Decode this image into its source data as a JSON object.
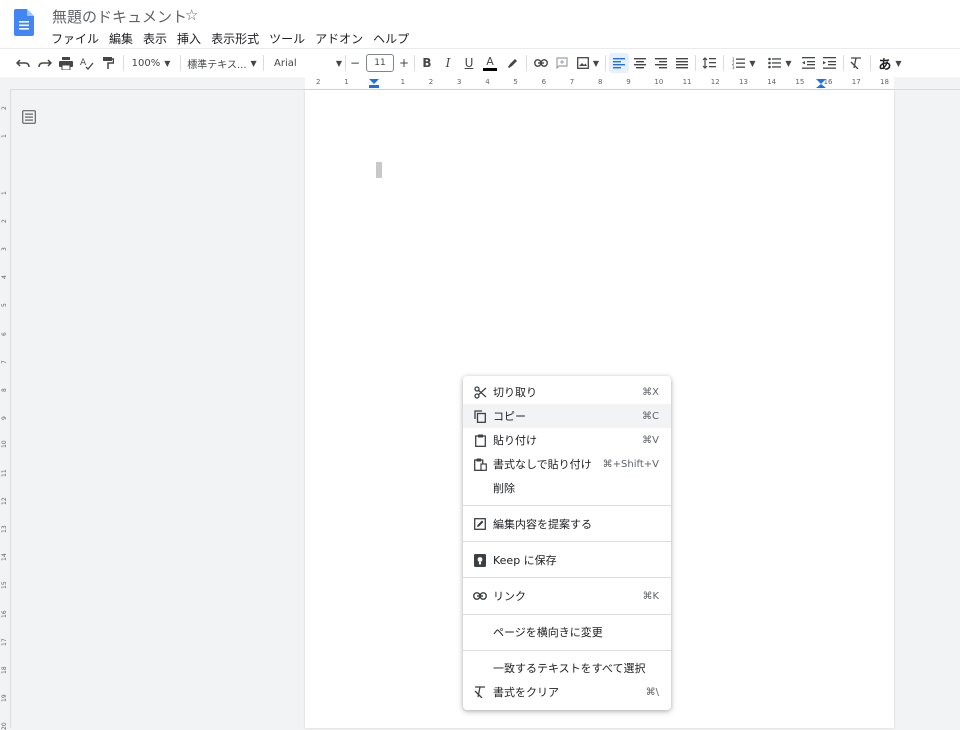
{
  "doc": {
    "title": "無題のドキュメント"
  },
  "menubar": [
    "ファイル",
    "編集",
    "表示",
    "挿入",
    "表示形式",
    "ツール",
    "アドオン",
    "ヘルプ"
  ],
  "toolbar": {
    "zoom": "100%",
    "style": "標準テキス...",
    "font": "Arial",
    "font_size": "11",
    "minus": "−",
    "plus": "+",
    "bold": "B",
    "italic": "I",
    "underline": "U",
    "text_color": "A",
    "input_tools": "あ"
  },
  "ruler": {
    "top_ticks": [
      "2",
      "1",
      "1",
      "2",
      "3",
      "4",
      "5",
      "6",
      "7",
      "8",
      "9",
      "10",
      "11",
      "12",
      "13",
      "14",
      "15",
      "16",
      "17",
      "18"
    ],
    "left_ticks": [
      "2",
      "1",
      "1",
      "2",
      "3",
      "4",
      "5",
      "6",
      "7",
      "8",
      "9",
      "10",
      "11",
      "12",
      "13",
      "14",
      "15",
      "16",
      "17",
      "18",
      "19",
      "20"
    ]
  },
  "context_menu": {
    "items": [
      {
        "label": "切り取り",
        "shortcut": "⌘X",
        "icon": "scissors-icon"
      },
      {
        "label": "コピー",
        "shortcut": "⌘C",
        "icon": "copy-icon"
      },
      {
        "label": "貼り付け",
        "shortcut": "⌘V",
        "icon": "clipboard-icon"
      },
      {
        "label": "書式なしで貼り付け",
        "shortcut": "⌘+Shift+V",
        "icon": "paste-plain-icon"
      },
      {
        "label": "削除",
        "shortcut": "",
        "icon": ""
      },
      {
        "label": "編集内容を提案する",
        "shortcut": "",
        "icon": "suggest-edit-icon"
      },
      {
        "label": "Keep に保存",
        "shortcut": "",
        "icon": "keep-icon"
      },
      {
        "label": "リンク",
        "shortcut": "⌘K",
        "icon": "link-icon"
      },
      {
        "label": "ページを横向きに変更",
        "shortcut": "",
        "icon": ""
      },
      {
        "label": "一致するテキストをすべて選択",
        "shortcut": "",
        "icon": ""
      },
      {
        "label": "書式をクリア",
        "shortcut": "⌘\\",
        "icon": "clear-format-icon"
      }
    ]
  },
  "colors": {
    "accent": "#1a73e8",
    "doc_logo": "#4285f4",
    "hover": "#f1f3f4"
  }
}
